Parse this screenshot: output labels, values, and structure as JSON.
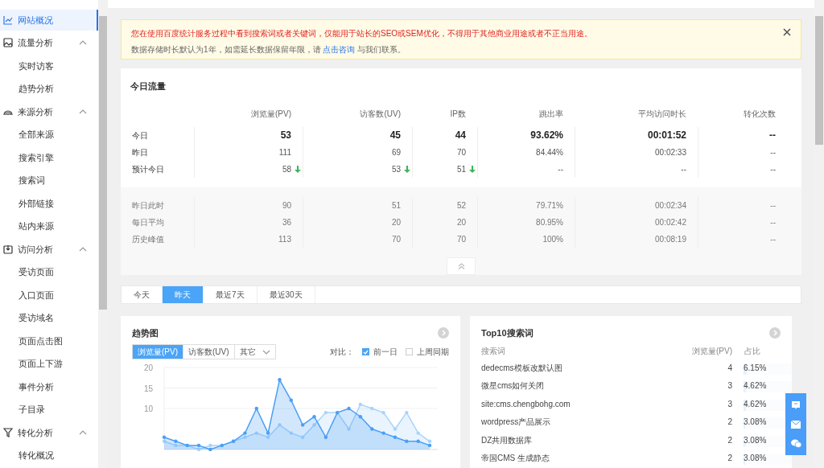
{
  "sidebar": {
    "items": [
      {
        "kind": "link",
        "label": "网站概况",
        "selected": true
      },
      {
        "kind": "group",
        "label": "流量分析",
        "expanded": true,
        "children": [
          {
            "label": "实时访客",
            "selected": false
          },
          {
            "label": "趋势分析",
            "selected": false
          }
        ]
      },
      {
        "kind": "group",
        "label": "来源分析",
        "expanded": true,
        "children": [
          {
            "label": "全部来源",
            "selected": false
          },
          {
            "label": "搜索引擎",
            "selected": false
          },
          {
            "label": "搜索词",
            "selected": false
          },
          {
            "label": "外部链接",
            "selected": false
          },
          {
            "label": "站内来源",
            "selected": false
          }
        ]
      },
      {
        "kind": "group",
        "label": "访问分析",
        "expanded": true,
        "children": [
          {
            "label": "受访页面",
            "selected": false
          },
          {
            "label": "入口页面",
            "selected": false
          },
          {
            "label": "受访域名",
            "selected": false
          },
          {
            "label": "页面点击图",
            "selected": false
          },
          {
            "label": "页面上下游",
            "selected": false
          },
          {
            "label": "事件分析",
            "selected": false
          },
          {
            "label": "子目录",
            "selected": false
          }
        ]
      },
      {
        "kind": "group",
        "label": "转化分析",
        "expanded": true,
        "children": [
          {
            "label": "转化概况",
            "selected": false
          }
        ]
      }
    ]
  },
  "notice": {
    "warning": "您在使用百度统计服务过程中看到搜索词或者关键词，仅能用于站长的SEO或SEM优化，不得用于其他商业用途或者不正当用途。",
    "info_before": "数据存储时长默认为1年，如需延长数据保留年限，请",
    "link": "点击咨询",
    "info_after": "与我们联系。"
  },
  "today_traffic": {
    "title": "今日流量",
    "columns": [
      "浏览量(PV)",
      "访客数(UV)",
      "IP数",
      "跳出率",
      "平均访问时长",
      "转化次数"
    ],
    "rows": [
      {
        "label": "今日",
        "emphasis": true,
        "cells": [
          {
            "value": "53"
          },
          {
            "value": "45"
          },
          {
            "value": "44"
          },
          {
            "value": "93.62%"
          },
          {
            "value": "00:01:52"
          },
          {
            "value": "--"
          }
        ]
      },
      {
        "label": "昨日",
        "emphasis": false,
        "cells": [
          {
            "value": "111"
          },
          {
            "value": "69"
          },
          {
            "value": "70"
          },
          {
            "value": "84.44%"
          },
          {
            "value": "00:02:33"
          },
          {
            "value": "--"
          }
        ]
      },
      {
        "label": "预计今日",
        "emphasis": false,
        "cells": [
          {
            "value": "58",
            "down": true
          },
          {
            "value": "53",
            "down": true
          },
          {
            "value": "51",
            "down": true
          },
          {
            "value": "--"
          },
          {
            "value": "--"
          },
          {
            "value": "--"
          }
        ]
      }
    ],
    "history_rows": [
      {
        "label": "昨日此时",
        "cells": [
          "90",
          "51",
          "52",
          "79.71%",
          "00:02:34",
          "--"
        ]
      },
      {
        "label": "每日平均",
        "cells": [
          "36",
          "20",
          "20",
          "80.95%",
          "00:02:42",
          "--"
        ]
      },
      {
        "label": "历史峰值",
        "cells": [
          "113",
          "70",
          "70",
          "100%",
          "00:08:19",
          "--"
        ]
      }
    ],
    "expanded": true
  },
  "date_tabs": [
    {
      "label": "今天",
      "selected": false
    },
    {
      "label": "昨天",
      "selected": true
    },
    {
      "label": "最近7天",
      "selected": false
    },
    {
      "label": "最近30天",
      "selected": false
    }
  ],
  "trend": {
    "title": "趋势图",
    "metric_tabs": [
      {
        "label": "浏览量(PV)",
        "selected": true
      },
      {
        "label": "访客数(UV)",
        "selected": false
      }
    ],
    "more_dropdown": "其它",
    "compare_label": "对比：",
    "compare_options": [
      {
        "label": "前一日",
        "checked": true
      },
      {
        "label": "上周同期",
        "checked": false
      }
    ],
    "chart_data": {
      "type": "area",
      "ylim": [
        0,
        20
      ],
      "yticks": [
        10,
        15,
        20
      ],
      "series": [
        {
          "color": "#4a9ff5",
          "values": [
            3,
            2,
            1,
            1,
            0,
            1,
            2,
            4,
            10,
            4,
            17,
            12,
            6,
            8,
            3,
            9,
            10,
            8,
            5,
            4,
            3,
            2,
            2,
            1
          ]
        },
        {
          "color": "#a9d3fb",
          "values": [
            2,
            1,
            1,
            0,
            1,
            1,
            2,
            3,
            4,
            3,
            6,
            4,
            3,
            6,
            9,
            9,
            5,
            11,
            10,
            9,
            5,
            9,
            4,
            2
          ]
        }
      ]
    }
  },
  "top_keywords": {
    "title": "Top10搜索词",
    "columns": [
      "搜索词",
      "浏览量(PV)",
      "占比"
    ],
    "rows": [
      {
        "term": "dedecms模板改默认图",
        "pv": "4",
        "share": "6.15%",
        "level": 0.0615
      },
      {
        "term": "微星cms如何关闭",
        "pv": "3",
        "share": "4.62%",
        "level": 0.0462
      },
      {
        "term": "site:cms.chengbohg.com",
        "pv": "3",
        "share": "4.62%",
        "level": 0.0462
      },
      {
        "term": "wordpress产品展示",
        "pv": "2",
        "share": "3.08%",
        "level": 0.0308
      },
      {
        "term": "DZ共用数据库",
        "pv": "2",
        "share": "3.08%",
        "level": 0.0308
      },
      {
        "term": "帝国CMS 生成静态",
        "pv": "2",
        "share": "3.08%",
        "level": 0.0308
      }
    ]
  }
}
